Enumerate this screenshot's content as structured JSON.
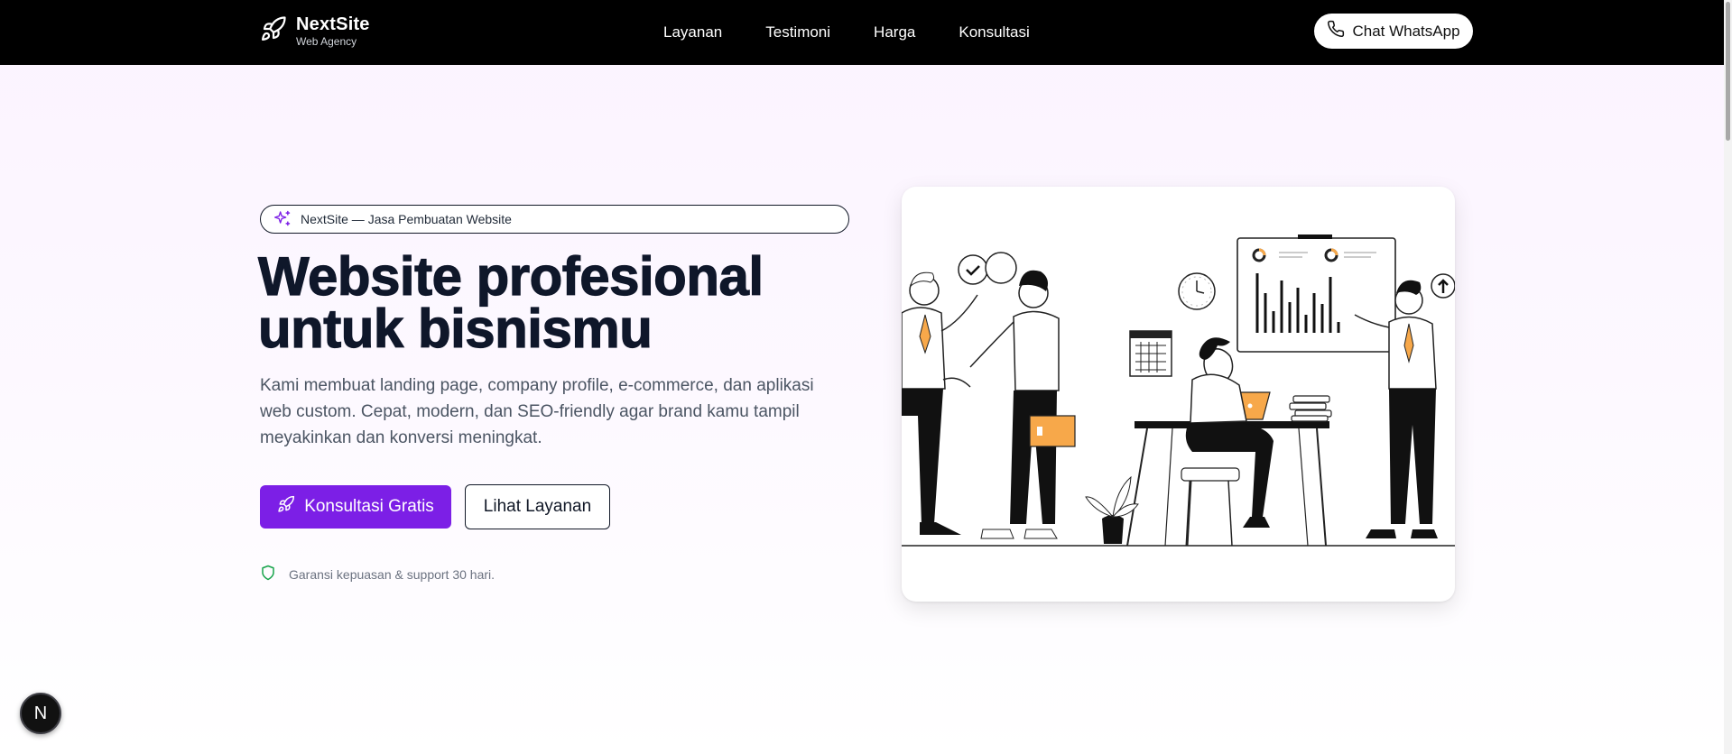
{
  "brand": {
    "name": "NextSite",
    "tagline": "Web Agency"
  },
  "nav": {
    "items": [
      "Layanan",
      "Testimoni",
      "Harga",
      "Konsultasi"
    ]
  },
  "header": {
    "whatsapp_label": "Chat WhatsApp"
  },
  "hero": {
    "badge": "NextSite — Jasa Pembuatan Website",
    "title_line1": "Website profesional",
    "title_line2": "untuk bisnismu",
    "description": "Kami membuat landing page, company profile, e-commerce, dan aplikasi web custom. Cepat, modern, dan SEO-friendly agar brand kamu tampil meyakinkan dan konversi meningkat.",
    "cta_primary": "Konsultasi Gratis",
    "cta_secondary": "Lihat Layanan",
    "guarantee": "Garansi kepuasan & support 30 hari."
  },
  "fab": {
    "label": "N"
  },
  "colors": {
    "accent": "#7c1fe6",
    "nav_bg": "#000000",
    "illustration_accent": "#f7a84a",
    "guarantee_icon": "#16a34a"
  },
  "icons": [
    "rocket-icon",
    "phone-icon",
    "sparkles-icon",
    "shield-icon"
  ]
}
